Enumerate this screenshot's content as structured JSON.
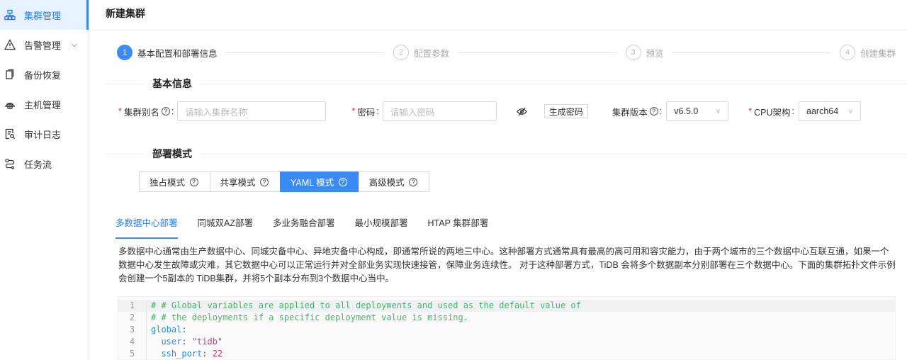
{
  "sidebar": {
    "items": [
      {
        "label": "集群管理",
        "icon": "cluster-icon",
        "active": true
      },
      {
        "label": "告警管理",
        "icon": "warning-icon",
        "expandable": true
      },
      {
        "label": "备份恢复",
        "icon": "backup-icon"
      },
      {
        "label": "主机管理",
        "icon": "host-icon"
      },
      {
        "label": "审计日志",
        "icon": "audit-log-icon"
      },
      {
        "label": "任务流",
        "icon": "workflow-icon"
      }
    ]
  },
  "header": {
    "title": "新建集群"
  },
  "steps": [
    {
      "num": "1",
      "label": "基本配置和部署信息"
    },
    {
      "num": "2",
      "label": "配置参数"
    },
    {
      "num": "3",
      "label": "预览"
    },
    {
      "num": "4",
      "label": "创建集群"
    }
  ],
  "basic": {
    "title": "基本信息",
    "alias_label": "集群别名",
    "alias_placeholder": "请输入集群名称",
    "password_label": "密码",
    "password_placeholder": "请输入密码",
    "gen_password": "生成密码",
    "version_label": "集群版本",
    "version_value": "v6.5.0",
    "cpu_label": "CPU架构",
    "cpu_value": "aarch64",
    "colon": ":"
  },
  "deploy": {
    "title": "部署模式",
    "modes": [
      "独占模式",
      "共享模式",
      "YAML 模式",
      "高级模式"
    ],
    "active_mode": 2
  },
  "tabs": [
    "多数据中心部署",
    "同城双AZ部署",
    "多业务融合部署",
    "最小规模部署",
    "HTAP 集群部署"
  ],
  "description": "多数据中心通常由生产数据中心、同城灾备中心、异地灾备中心构成，即通常所说的两地三中心。这种部署方式通常具有最高的高可用和容灾能力，由于两个城市的三个数据中心互联互通，如果一个数据中心发生故障或灾难，其它数据中心可以正常运行并对全部业务实现快速接管，保障业务连续性。 对于这种部署方式，TiDB 会将多个数据副本分别部署在三个数据中心。下面的集群拓扑文件示例会创建一个5副本的 TiDB集群，并将5个副本分布到3个数据中心当中。",
  "code": {
    "lines": [
      {
        "n": "1",
        "comment": "# # Global variables are applied to all deployments and used as the default value of"
      },
      {
        "n": "2",
        "comment": "# # the deployments if a specific deployment value is missing."
      },
      {
        "n": "3",
        "key": "global",
        "sep": ":"
      },
      {
        "n": "4",
        "indent": "  ",
        "key": "user",
        "sep": ": ",
        "str": "\"tidb\""
      },
      {
        "n": "5",
        "indent": "  ",
        "key": "ssh_port",
        "sep": ": ",
        "num": "22"
      }
    ]
  },
  "colors": {
    "accent": "#3b8bf5",
    "required": "#f5222d"
  }
}
